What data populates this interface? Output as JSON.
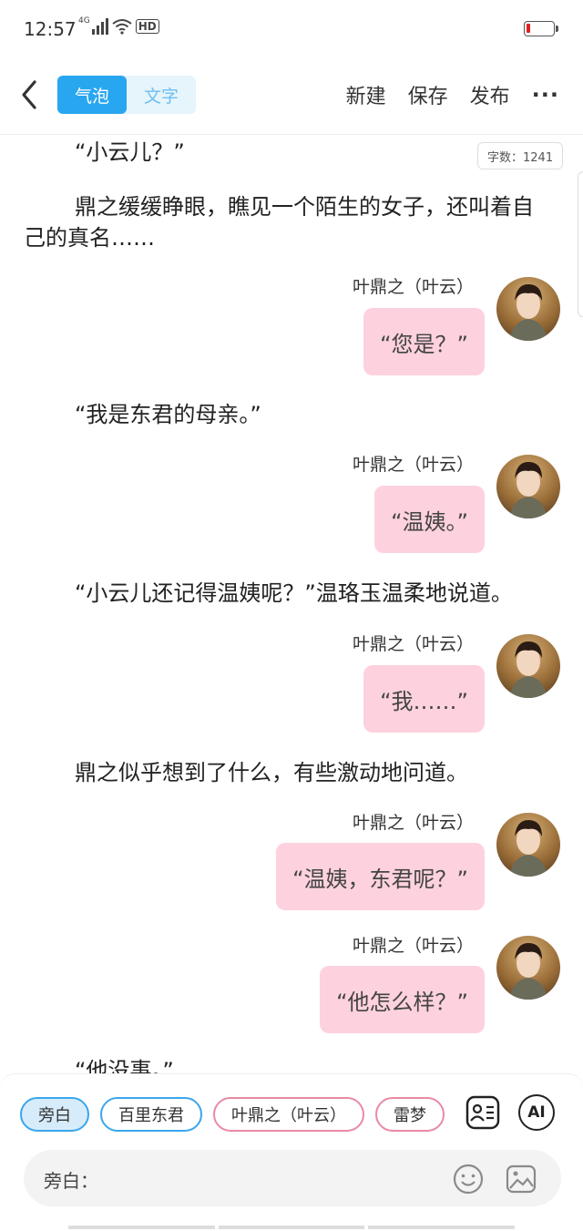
{
  "status": {
    "time": "12:57",
    "network": "4G",
    "hd": "HD"
  },
  "header": {
    "tab_bubble": "气泡",
    "tab_text": "文字",
    "new_label": "新建",
    "save_label": "保存",
    "publish_label": "发布",
    "more_label": "···"
  },
  "content": {
    "word_count": "字数：1241",
    "p1": "“小云儿？”",
    "p2": "鼎之缓缓睁眼，瞧见一个陌生的女子，还叫着自己的真名……",
    "p3": "“我是东君的母亲。”",
    "p4": "“小云儿还记得温姨呢？”温珞玉温柔地说道。",
    "p5": "鼎之似乎想到了什么，有些激动地问道。",
    "p6": "“他没事。”",
    "messages": [
      {
        "speaker": "叶鼎之（叶云）",
        "text": "“您是？”"
      },
      {
        "speaker": "叶鼎之（叶云）",
        "text": "“温姨。”"
      },
      {
        "speaker": "叶鼎之（叶云）",
        "text": "“我……”"
      },
      {
        "speaker": "叶鼎之（叶云）",
        "text": "“温姨，东君呢？”"
      },
      {
        "speaker": "叶鼎之（叶云）",
        "text": "“他怎么样？”"
      }
    ]
  },
  "bottom": {
    "chips": [
      "旁白",
      "百里东君",
      "叶鼎之（叶云）",
      "雷梦"
    ],
    "ai_label": "AI",
    "input_label": "旁白："
  },
  "colors": {
    "accent": "#29a6f0",
    "bubble": "#fdd2de",
    "chip_pink": "#e98aa4"
  }
}
